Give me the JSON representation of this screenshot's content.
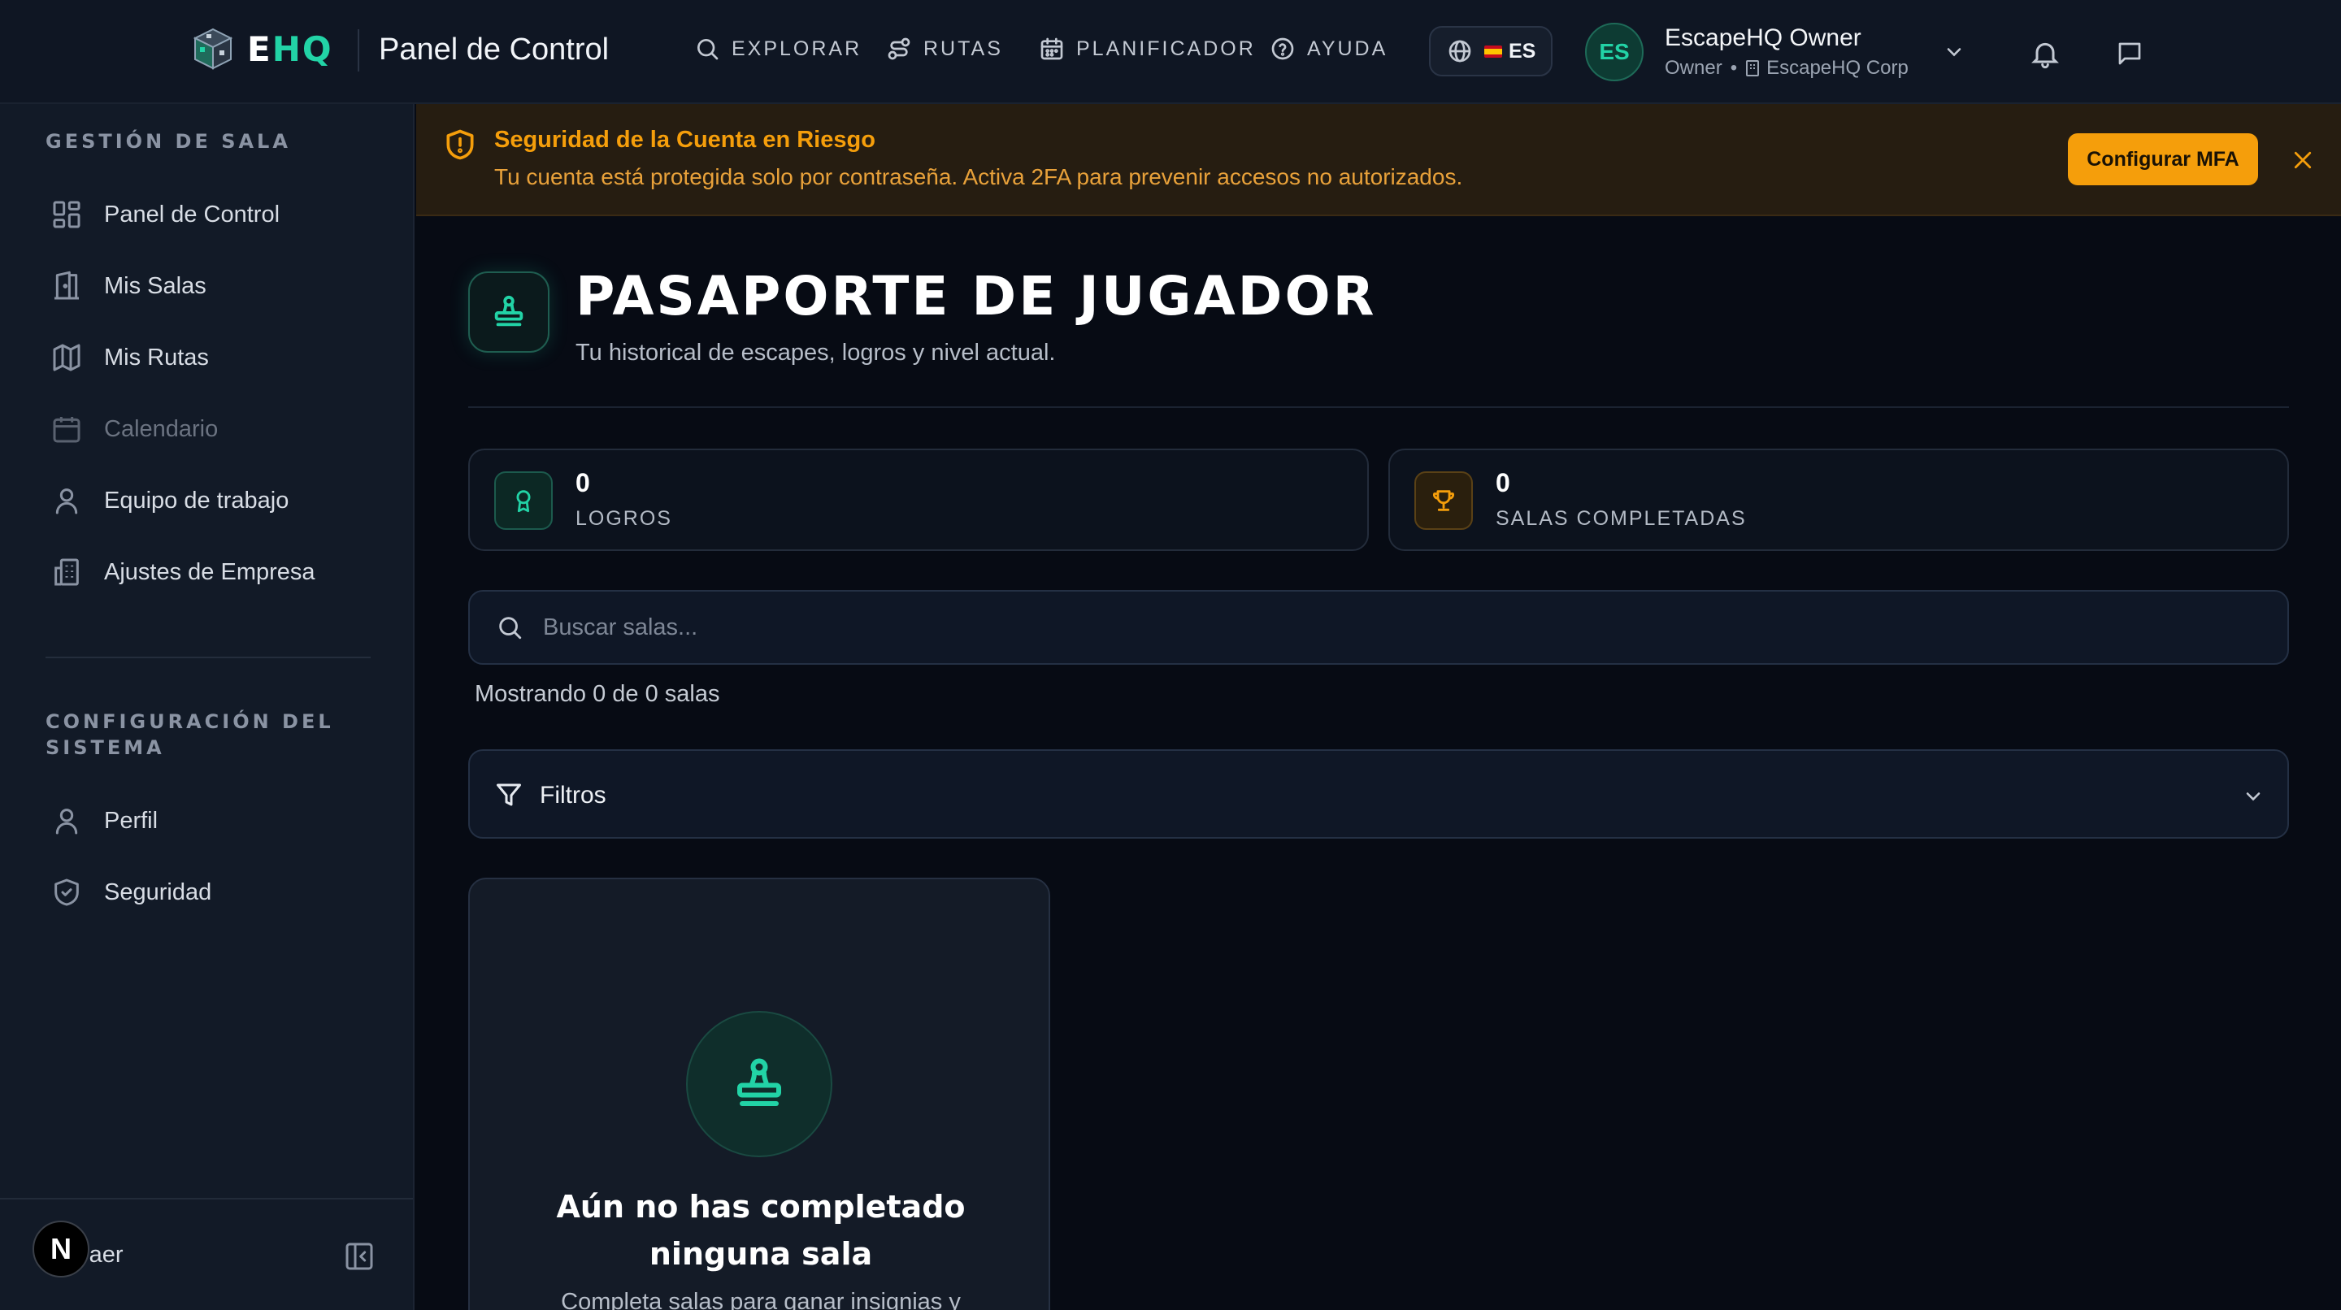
{
  "header": {
    "logo_prefix": "E",
    "logo_suffix": "HQ",
    "app_title": "Panel de Control",
    "nav": [
      {
        "label": "EXPLORAR",
        "icon": "search-icon"
      },
      {
        "label": "RUTAS",
        "icon": "route-icon"
      },
      {
        "label": "PLANIFICADOR",
        "icon": "calendar-icon"
      },
      {
        "label": "AYUDA",
        "icon": "help-icon"
      }
    ],
    "language": "ES",
    "user": {
      "initials": "ES",
      "name": "EscapeHQ Owner",
      "role": "Owner",
      "separator": "•",
      "company": "EscapeHQ Corp"
    }
  },
  "sidebar": {
    "section1_title": "GESTIÓN DE SALA",
    "section1_items": [
      {
        "label": "Panel de Control",
        "icon": "dashboard-icon"
      },
      {
        "label": "Mis Salas",
        "icon": "door-icon"
      },
      {
        "label": "Mis Rutas",
        "icon": "map-icon"
      },
      {
        "label": "Calendario",
        "icon": "calendar-icon",
        "disabled": true
      },
      {
        "label": "Equipo de trabajo",
        "icon": "user-icon"
      },
      {
        "label": "Ajustes de Empresa",
        "icon": "building-icon"
      }
    ],
    "section2_title": "CONFIGURACIÓN DEL SISTEMA",
    "section2_items": [
      {
        "label": "Perfil",
        "icon": "user-icon"
      },
      {
        "label": "Seguridad",
        "icon": "shield-check-icon"
      }
    ],
    "collapse_label": "raer",
    "badge_letter": "N"
  },
  "alert": {
    "title": "Seguridad de la Cuenta en Riesgo",
    "text": "Tu cuenta está protegida solo por contraseña. Activa 2FA para prevenir accesos no autorizados.",
    "button": "Configurar MFA"
  },
  "main": {
    "title": "PASAPORTE DE JUGADOR",
    "subtitle": "Tu historical de escapes, logros y nivel actual.",
    "stats": [
      {
        "value": "0",
        "label": "LOGROS",
        "icon": "award-icon"
      },
      {
        "value": "0",
        "label": "SALAS COMPLETADAS",
        "icon": "trophy-icon"
      }
    ],
    "search_placeholder": "Buscar salas...",
    "showing": "Mostrando 0 de 0 salas",
    "filters_label": "Filtros",
    "empty_title": "Aún no has completado ninguna sala",
    "empty_text": "Completa salas para ganar insignias y"
  },
  "colors": {
    "accent": "#22d3a6",
    "warning": "#f59e0b",
    "background": "#070b14",
    "sidebar": "#121a27"
  }
}
